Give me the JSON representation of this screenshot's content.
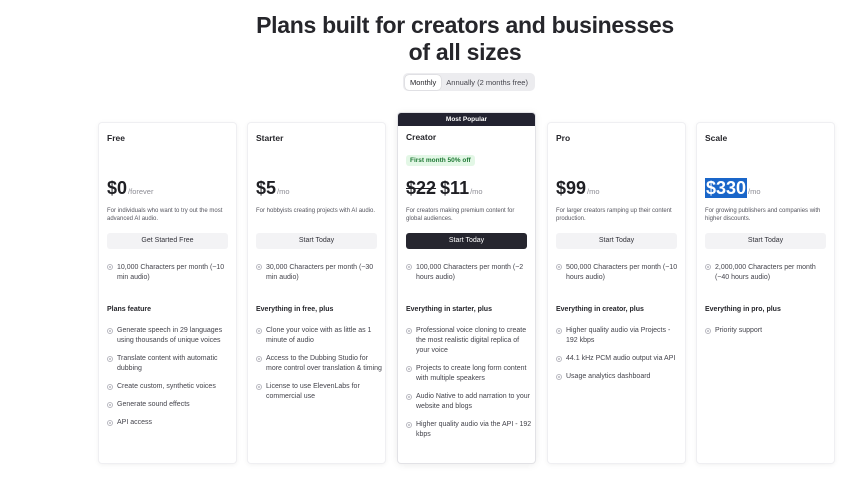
{
  "header": {
    "title_line1": "Plans built for creators and businesses",
    "title_line2": "of all sizes"
  },
  "billing_toggle": {
    "monthly": "Monthly",
    "annually": "Annually (2 months free)",
    "selected": "Monthly"
  },
  "plans": [
    {
      "name": "Free",
      "price": "$0",
      "period": "/forever",
      "description": "For individuals who want to try out the most advanced AI audio.",
      "button": "Get Started Free",
      "characters": "10,000 Characters per month (~10 min audio)",
      "features_heading": "Plans feature",
      "features": [
        "Generate speech in 29 languages using thousands of unique voices",
        "Translate content with automatic dubbing",
        "Create custom, synthetic voices",
        "Generate sound effects",
        "API access"
      ]
    },
    {
      "name": "Starter",
      "price": "$5",
      "period": "/mo",
      "description": "For hobbyists creating projects with AI audio.",
      "button": "Start Today",
      "characters": "30,000 Characters per month (~30 min audio)",
      "features_heading": "Everything in free, plus",
      "features": [
        "Clone your voice with as little as 1 minute of audio",
        "Access to the Dubbing Studio for more control over translation & timing",
        "License to use ElevenLabs for commercial use"
      ]
    },
    {
      "name": "Creator",
      "popular_label": "Most Popular",
      "badge": "First month 50% off",
      "old_price": "$22",
      "price": "$11",
      "period": "/mo",
      "description": "For creators making premium content for global audiences.",
      "button": "Start Today",
      "characters": "100,000 Characters per month (~2 hours audio)",
      "features_heading": "Everything in starter, plus",
      "features": [
        "Professional voice cloning to create the most realistic digital replica of your voice",
        "Projects to create long form content with multiple speakers",
        "Audio Native to add narration to your website and blogs",
        "Higher quality audio via the API - 192 kbps"
      ]
    },
    {
      "name": "Pro",
      "price": "$99",
      "period": "/mo",
      "description": "For larger creators ramping up their content production.",
      "button": "Start Today",
      "characters": "500,000 Characters per month (~10 hours audio)",
      "features_heading": "Everything in creator, plus",
      "features": [
        "Higher quality audio via Projects - 192 kbps",
        "44.1 kHz PCM audio output via API",
        "Usage analytics dashboard"
      ]
    },
    {
      "name": "Scale",
      "price": "$330",
      "period": "/mo",
      "description": "For growing publishers and companies with higher discounts.",
      "button": "Start Today",
      "characters": "2,000,000 Characters per month (~40 hours audio)",
      "features_heading": "Everything in pro, plus",
      "features": [
        "Priority support"
      ]
    }
  ],
  "colors": {
    "dark_button": "#26262f",
    "badge_bg": "#e3f7e6",
    "badge_text": "#1f7a35",
    "selection": "#1a66c9"
  }
}
